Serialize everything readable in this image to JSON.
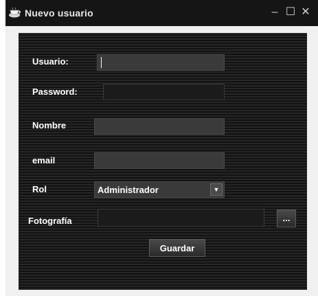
{
  "window": {
    "title": "Nuevo usuario",
    "minimize_glyph": "–",
    "maximize_glyph": "☐",
    "close_glyph": "✕"
  },
  "form": {
    "usuario_label": "Usuario:",
    "usuario_value": "",
    "password_label": "Password:",
    "password_value": "",
    "nombre_label": "Nombre",
    "nombre_value": "",
    "email_label": "email",
    "email_value": "",
    "rol_label": "Rol",
    "rol_selected": "Administrador",
    "fotografia_label": "Fotografía",
    "fotografia_value": "",
    "browse_label": "...",
    "save_label": "Guardar"
  },
  "icons": {
    "title": "coffee-cup-icon",
    "dropdown": "chevron-down-icon"
  },
  "colors": {
    "panel_stripe_light": "#262626",
    "panel_stripe_dark": "#121212",
    "field_background": "#3a3a3a",
    "text": "#ffffff"
  }
}
